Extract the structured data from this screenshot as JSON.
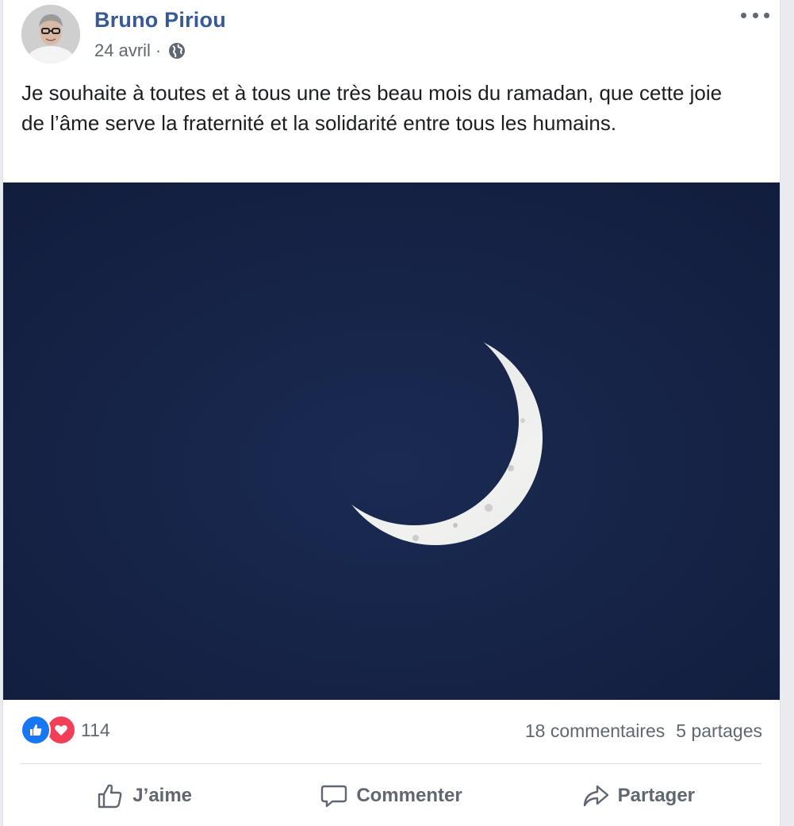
{
  "post": {
    "author": "Bruno Piriou",
    "date": "24 avril",
    "separator": "·",
    "privacy_icon": "globe-icon",
    "more_icon": "more-horizontal-icon",
    "text": "Je souhaite à toutes et à tous une très beau mois du ramadan, que cette joie de l’âme serve la fraternité et la solidarité entre tous les humains."
  },
  "reactions": {
    "icons": [
      "like-reaction-icon",
      "love-reaction-icon"
    ],
    "count": "114",
    "comments": "18 commentaires",
    "shares": "5 partages"
  },
  "actions": {
    "like": "J’aime",
    "comment": "Commenter",
    "share": "Partager"
  },
  "colors": {
    "author": "#385898",
    "like_blue": "#1877f2",
    "love_red": "#f33e58",
    "sky": "#131f3f"
  }
}
